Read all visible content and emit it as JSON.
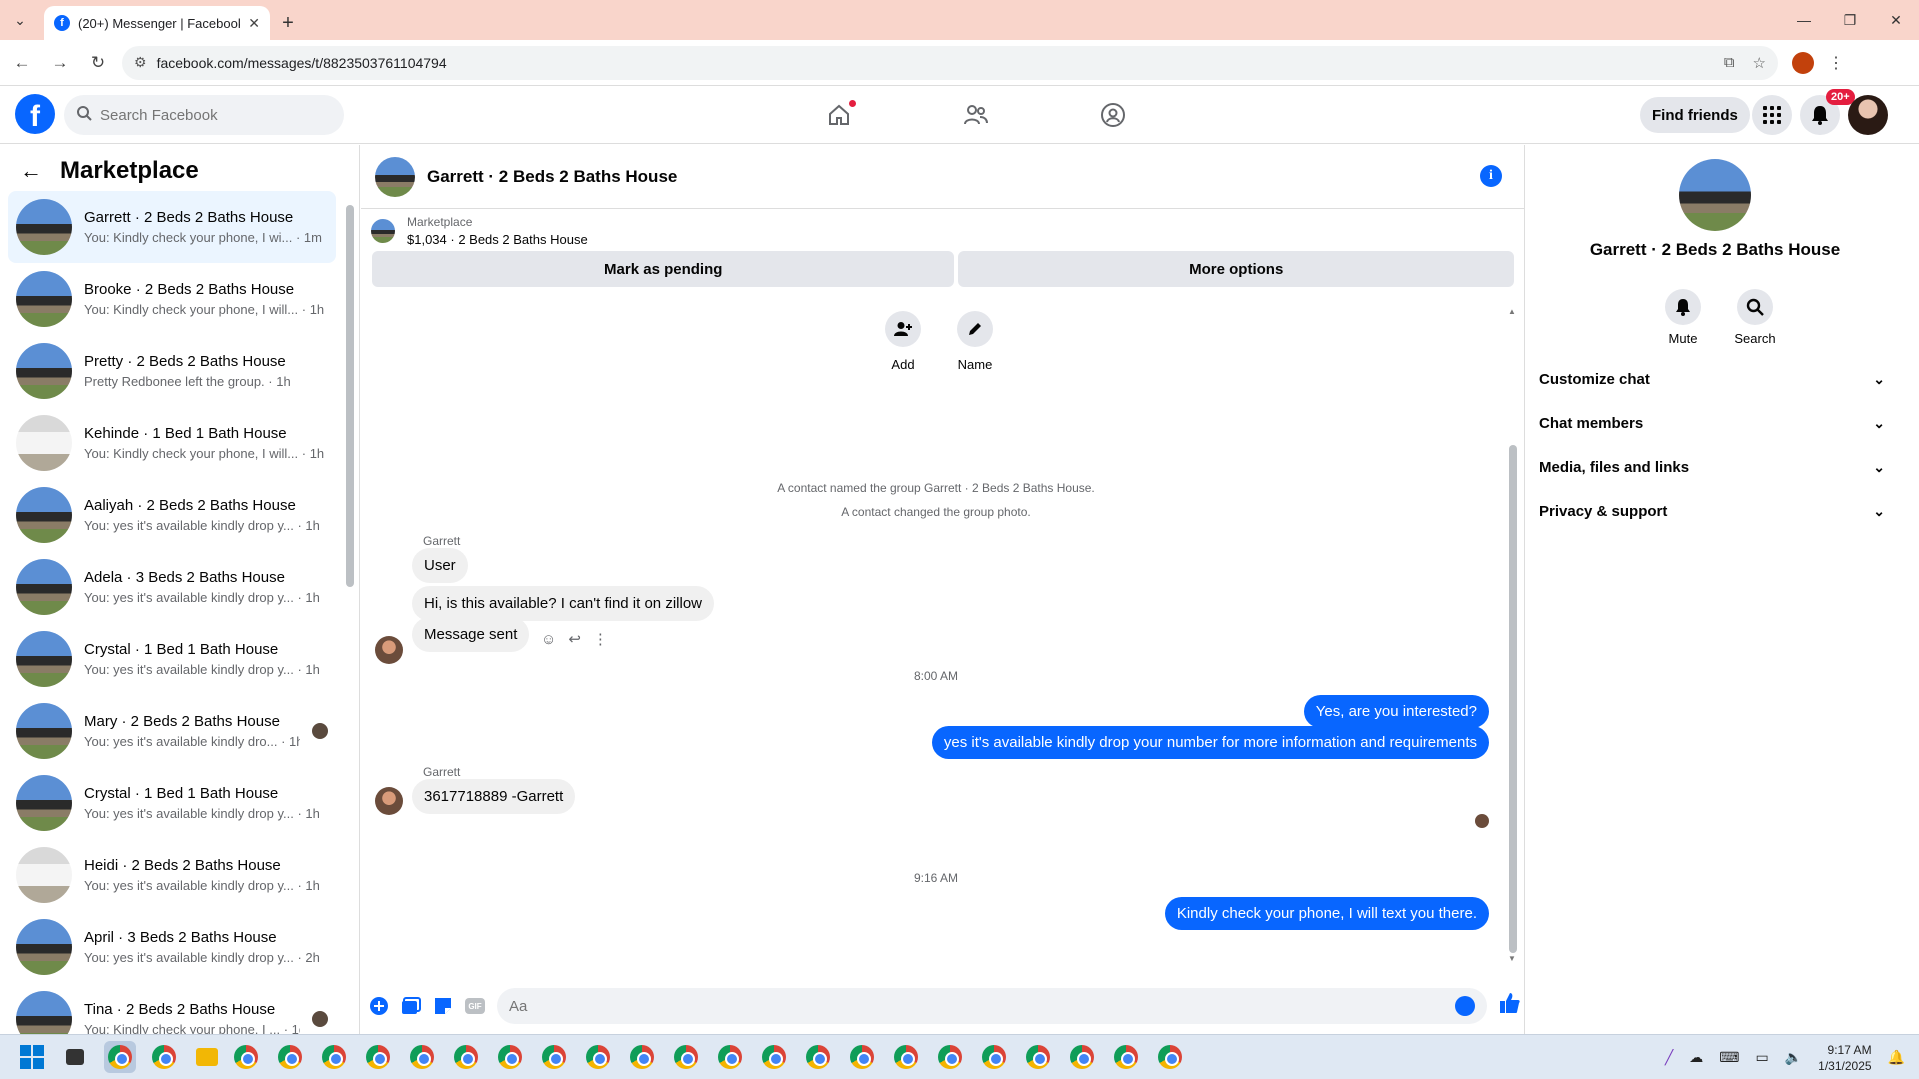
{
  "browser": {
    "tab_title": "(20+) Messenger | Facebook",
    "url": "facebook.com/messages/t/8823503761104794"
  },
  "fb_header": {
    "search_placeholder": "Search Facebook",
    "find_friends": "Find friends",
    "notif_badge": "20+"
  },
  "sidebar": {
    "title": "Marketplace",
    "conversations": [
      {
        "name": "Garrett · 2 Beds 2 Baths House",
        "preview": "You: Kindly check your phone, I wi... · 1m",
        "active": true
      },
      {
        "name": "Brooke · 2 Beds 2 Baths House",
        "preview": "You: Kindly check your phone, I will... · 1h"
      },
      {
        "name": "Pretty · 2 Beds 2 Baths House",
        "preview": "Pretty Redbonee left the group. · 1h"
      },
      {
        "name": "Kehinde · 1 Bed 1 Bath House",
        "preview": "You: Kindly check your phone, I will... · 1h"
      },
      {
        "name": "Aaliyah · 2 Beds 2 Baths House",
        "preview": "You: yes it's available kindly drop y... · 1h"
      },
      {
        "name": "Adela · 3 Beds 2 Baths House",
        "preview": "You: yes it's available kindly drop y... · 1h"
      },
      {
        "name": "Crystal · 1 Bed 1 Bath House",
        "preview": "You: yes it's available kindly drop y... · 1h"
      },
      {
        "name": "Mary · 2 Beds 2 Baths House",
        "preview": "You: yes it's available kindly dro... · 1h"
      },
      {
        "name": "Crystal · 1 Bed 1 Bath House",
        "preview": "You: yes it's available kindly drop y... · 1h"
      },
      {
        "name": "Heidi · 2 Beds 2 Baths House",
        "preview": "You: yes it's available kindly drop y... · 1h"
      },
      {
        "name": "April · 3 Beds 2 Baths House",
        "preview": "You: yes it's available kindly drop y... · 2h"
      },
      {
        "name": "Tina · 2 Beds 2 Baths House",
        "preview": "You: Kindly check your phone, I ... · 1d"
      }
    ]
  },
  "chat": {
    "title": "Garrett · 2 Beds 2 Baths House",
    "marketplace_label": "Marketplace",
    "listing": "$1,034 · 2 Beds 2 Baths House",
    "mark_pending": "Mark as pending",
    "more_options": "More options",
    "group_add": "Add",
    "group_name": "Name",
    "sys_1": "A contact named the group Garrett · 2 Beds 2 Baths House.",
    "sys_2": "A contact changed the group photo.",
    "sender_1": "Garrett",
    "msg_user": "User",
    "msg_available": "Hi, is this available? I can't find it on zillow",
    "msg_sent": "Message sent",
    "time_1": "8:00 AM",
    "out_1": "Yes, are you interested?",
    "out_2": "yes it's available kindly drop your number for more information and requirements",
    "sender_2": "Garrett",
    "msg_phone": "3617718889 -Garrett",
    "time_2": "9:16 AM",
    "out_3": "Kindly check your phone, I will text you there.",
    "composer_placeholder": "Aa"
  },
  "right_panel": {
    "name": "Garrett · 2 Beds 2 Baths House",
    "mute": "Mute",
    "search": "Search",
    "sections": [
      "Customize chat",
      "Chat members",
      "Media, files and links",
      "Privacy & support"
    ]
  },
  "taskbar": {
    "time": "9:17 AM",
    "date": "1/31/2025"
  },
  "colors": {
    "brand_blue": "#0866ff",
    "active_conv_bg": "#ebf5ff",
    "tabbar_bg": "#f9d5cb"
  }
}
